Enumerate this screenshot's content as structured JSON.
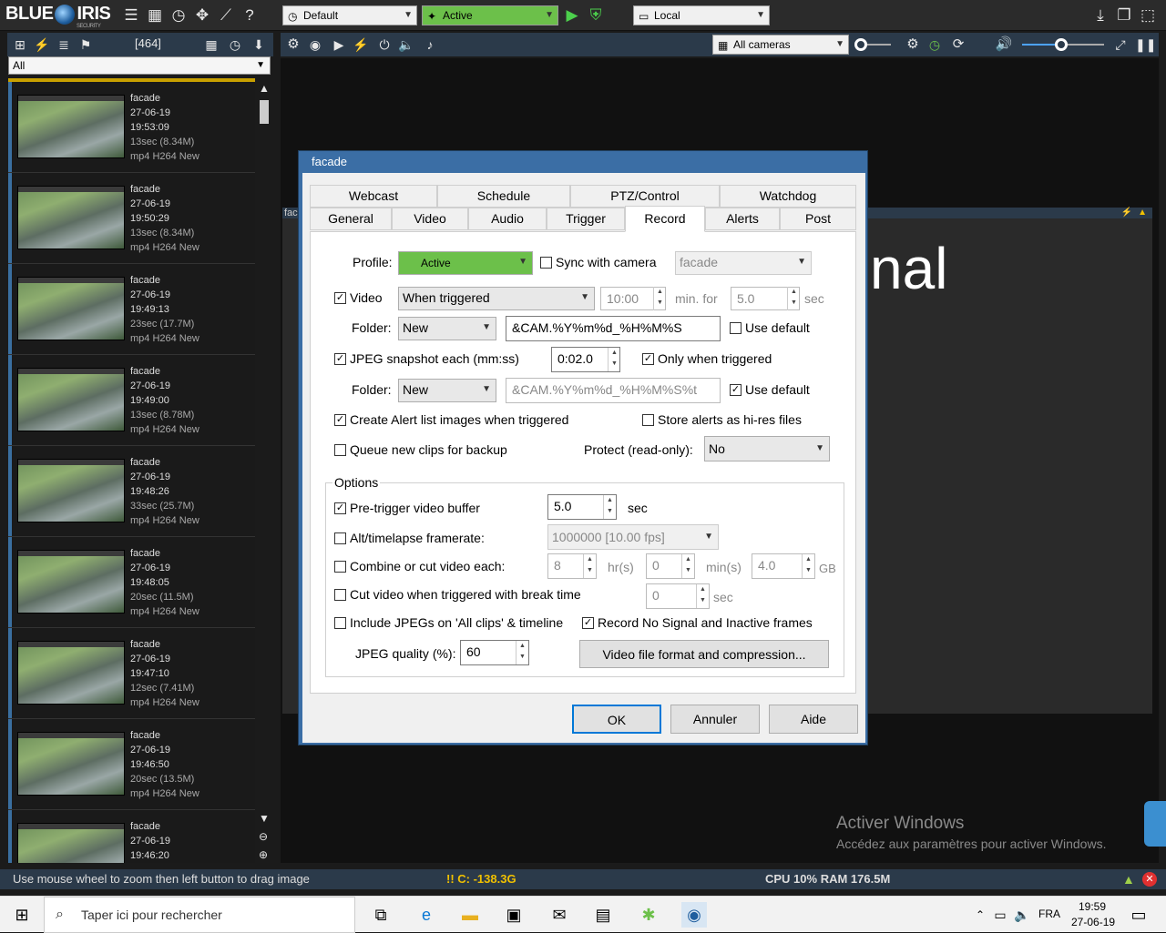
{
  "app": {
    "logo_left": "BLUE",
    "logo_right": "IRIS",
    "logo_sub": "SECURITY"
  },
  "top": {
    "profile_dd": "Default",
    "state_dd": "Active",
    "location_dd": "Local"
  },
  "left": {
    "count": "[464]",
    "filter": "All"
  },
  "right": {
    "camera_group": "All cameras"
  },
  "clips": [
    {
      "cam": "facade",
      "date": "27-06-19",
      "time": "19:53:09",
      "size": "13sec (8.34M)",
      "fmt": "mp4 H264 New"
    },
    {
      "cam": "facade",
      "date": "27-06-19",
      "time": "19:50:29",
      "size": "13sec (8.34M)",
      "fmt": "mp4 H264 New"
    },
    {
      "cam": "facade",
      "date": "27-06-19",
      "time": "19:49:13",
      "size": "23sec (17.7M)",
      "fmt": "mp4 H264 New"
    },
    {
      "cam": "facade",
      "date": "27-06-19",
      "time": "19:49:00",
      "size": "13sec (8.78M)",
      "fmt": "mp4 H264 New"
    },
    {
      "cam": "facade",
      "date": "27-06-19",
      "time": "19:48:26",
      "size": "33sec (25.7M)",
      "fmt": "mp4 H264 New"
    },
    {
      "cam": "facade",
      "date": "27-06-19",
      "time": "19:48:05",
      "size": "20sec (11.5M)",
      "fmt": "mp4 H264 New"
    },
    {
      "cam": "facade",
      "date": "27-06-19",
      "time": "19:47:10",
      "size": "12sec (7.41M)",
      "fmt": "mp4 H264 New"
    },
    {
      "cam": "facade",
      "date": "27-06-19",
      "time": "19:46:50",
      "size": "20sec (13.5M)",
      "fmt": "mp4 H264 New"
    },
    {
      "cam": "facade",
      "date": "27-06-19",
      "time": "19:46:20",
      "size": "",
      "fmt": ""
    }
  ],
  "camtile": {
    "label": "fac",
    "big_text": "nal"
  },
  "dialog": {
    "title": "facade",
    "tabs_row1": [
      "Webcast",
      "Schedule",
      "PTZ/Control",
      "Watchdog"
    ],
    "tabs_row2": [
      "General",
      "Video",
      "Audio",
      "Trigger",
      "Record",
      "Alerts",
      "Post"
    ],
    "profile_label": "Profile:",
    "profile_value": "Active",
    "sync_label": "Sync with camera",
    "sync_value": "facade",
    "video_label": "Video",
    "video_mode": "When triggered",
    "video_time": "10:00",
    "min_for": "min. for",
    "video_sec_value": "5.0",
    "sec": "sec",
    "folder_label": "Folder:",
    "folder_value": "New",
    "filename": "&CAM.%Y%m%d_%H%M%S",
    "use_default": "Use default",
    "jpeg_label": "JPEG snapshot each (mm:ss)",
    "jpeg_value": "0:02.0",
    "only_triggered": "Only when triggered",
    "jpeg_filename": "&CAM.%Y%m%d_%H%M%S%t",
    "alert_images": "Create Alert list images when triggered",
    "store_hires": "Store alerts as hi-res files",
    "queue_backup": "Queue new clips for backup",
    "protect_label": "Protect (read-only):",
    "protect_value": "No",
    "options_title": "Options",
    "pretrigger": "Pre-trigger video buffer",
    "pretrigger_value": "5.0",
    "alt_timelapse": "Alt/timelapse framerate:",
    "alt_value": "1000000 [10.00 fps]",
    "combine_cut": "Combine or cut video each:",
    "hrs_value": "8",
    "hrs": "hr(s)",
    "mins_value": "0",
    "mins": "min(s)",
    "gb_value": "4.0",
    "gb": "GB",
    "cut_break": "Cut video when triggered with break time",
    "break_value": "0",
    "include_jpegs": "Include JPEGs on 'All clips' & timeline",
    "record_nosignal": "Record No Signal and Inactive frames",
    "jpeg_quality_label": "JPEG quality (%):",
    "jpeg_quality": "60",
    "video_format_btn": "Video file format and compression...",
    "ok": "OK",
    "cancel": "Annuler",
    "help": "Aide"
  },
  "status": {
    "hint": "Use mouse wheel to zoom then left button to drag image",
    "disk": "!! C: -138.3G",
    "cpu": "CPU 10% RAM 176.5M"
  },
  "watermark": {
    "line1": "Activer Windows",
    "line2": "Accédez aux paramètres pour activer Windows."
  },
  "taskbar": {
    "search": "Taper ici pour rechercher",
    "lang": "FRA",
    "time": "19:59",
    "date": "27-06-19"
  }
}
